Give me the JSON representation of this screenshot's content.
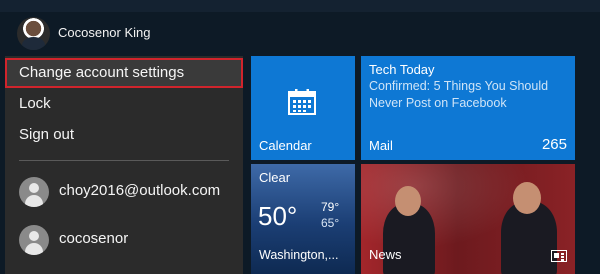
{
  "user": {
    "name": "Cocosenor King"
  },
  "menu": {
    "items": [
      {
        "label": "Change account settings",
        "selected": true
      },
      {
        "label": "Lock"
      },
      {
        "label": "Sign out"
      }
    ],
    "accounts": [
      {
        "label": "choy2016@outlook.com"
      },
      {
        "label": "cocosenor"
      }
    ]
  },
  "tiles": {
    "calendar": {
      "label": "Calendar",
      "icon": "calendar-icon"
    },
    "mail": {
      "label": "Mail",
      "title": "Tech Today",
      "body": "Confirmed: 5 Things You Should Never Post on Facebook",
      "count": "265"
    },
    "weather": {
      "condition": "Clear",
      "temp": "50°",
      "high": "79°",
      "low": "65°",
      "city": "Washington,..."
    },
    "news": {
      "label": "News",
      "icon": "news-icon"
    }
  },
  "colors": {
    "accent": "#0e78d4",
    "selection_border": "#d0242c",
    "menu_bg": "#2b2b2b",
    "background": "#0d1a26"
  }
}
